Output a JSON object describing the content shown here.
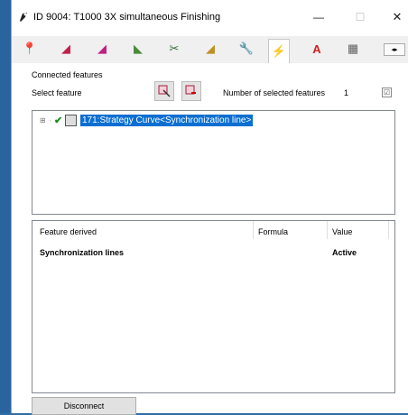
{
  "window": {
    "title": "ID 9004: T1000 3X simultaneous Finishing",
    "minimize": "—",
    "maximize": "☐",
    "close": "✕"
  },
  "tabs": [
    {
      "icon": "pin-icon",
      "glyph": "📍",
      "color": "#555555"
    },
    {
      "icon": "tool-red-icon",
      "glyph": "◢",
      "color": "#c0204a"
    },
    {
      "icon": "tool-magenta-icon",
      "glyph": "◢",
      "color": "#c02080"
    },
    {
      "icon": "tool-green-icon",
      "glyph": "◣",
      "color": "#4a8a3a"
    },
    {
      "icon": "toolpath-icon",
      "glyph": "✂",
      "color": "#3a6a3a"
    },
    {
      "icon": "tool-yellow-icon",
      "glyph": "◢",
      "color": "#c09020"
    },
    {
      "icon": "wrench-icon",
      "glyph": "🔧",
      "color": "#5050a0"
    },
    {
      "icon": "strategy-icon",
      "glyph": "⚡",
      "color": "#a02030",
      "active": true
    },
    {
      "icon": "text-a-icon",
      "glyph": "A",
      "color": "#d02020"
    },
    {
      "icon": "settings-grid-icon",
      "glyph": "▦",
      "color": "#606060"
    }
  ],
  "tab_scroll": "◂▸",
  "connected": {
    "group_title": "Connected features",
    "select_label": "Select feature",
    "count_label": "Number of selected features",
    "count_value": "1",
    "checkbox_glyph": "☑"
  },
  "tree": {
    "item_text": "171:Strategy Curve<Synchronization line>"
  },
  "table": {
    "headers": [
      "Feature derived",
      "Formula",
      "Value"
    ],
    "rows": [
      {
        "feature": "Synchronization lines",
        "formula": "",
        "value": "Active"
      }
    ]
  },
  "buttons": {
    "disconnect": "Disconnect"
  }
}
